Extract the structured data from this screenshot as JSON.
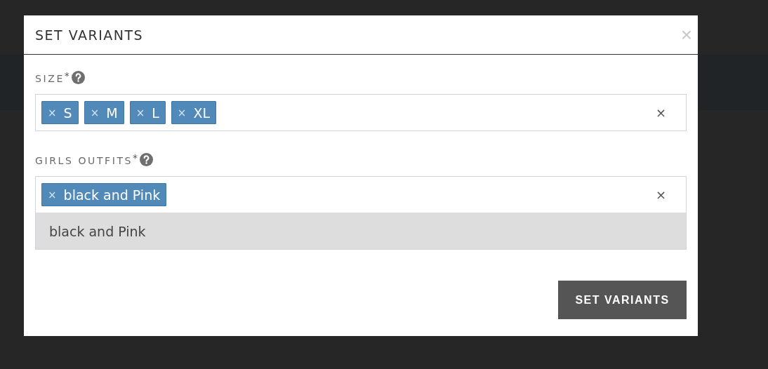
{
  "modal": {
    "title": "SET VARIANTS",
    "close": "×"
  },
  "fields": [
    {
      "label": "SIZE",
      "required": true,
      "tags": [
        "S",
        "M",
        "L",
        "XL"
      ],
      "clear": "×"
    },
    {
      "label": "GIRLS OUTFITS",
      "required": true,
      "tags": [
        "black and Pink"
      ],
      "clear": "×",
      "options": [
        {
          "label": "black and Pink",
          "selected": true
        }
      ]
    }
  ],
  "tag_remove": "×",
  "required_mark": "*",
  "submit": "SET VARIANTS"
}
